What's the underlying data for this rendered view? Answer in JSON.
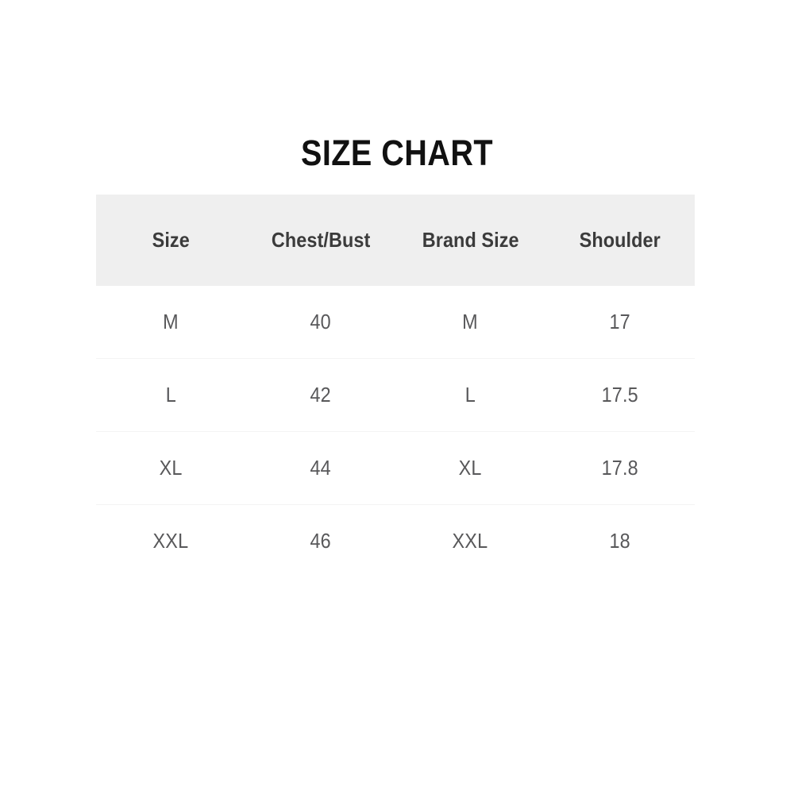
{
  "title": "SIZE CHART",
  "colors": {
    "background": "#ffffff",
    "title_text": "#111111",
    "header_background": "#efefef",
    "header_text": "#3b3b3b",
    "body_text": "#58585a",
    "row_divider": "#f4f4f4"
  },
  "table": {
    "headers": [
      "Size",
      "Chest/Bust",
      "Brand Size",
      "Shoulder"
    ],
    "rows": [
      {
        "size": "M",
        "chest_bust": "40",
        "brand_size": "M",
        "shoulder": "17"
      },
      {
        "size": "L",
        "chest_bust": "42",
        "brand_size": "L",
        "shoulder": "17.5"
      },
      {
        "size": "XL",
        "chest_bust": "44",
        "brand_size": "XL",
        "shoulder": "17.8"
      },
      {
        "size": "XXL",
        "chest_bust": "46",
        "brand_size": "XXL",
        "shoulder": "18"
      }
    ]
  },
  "chart_data": {
    "type": "table",
    "title": "SIZE CHART",
    "columns": [
      "Size",
      "Chest/Bust",
      "Brand Size",
      "Shoulder"
    ],
    "data": [
      [
        "M",
        "40",
        "M",
        "17"
      ],
      [
        "L",
        "42",
        "L",
        "17.5"
      ],
      [
        "XL",
        "44",
        "XL",
        "17.8"
      ],
      [
        "XXL",
        "46",
        "XXL",
        "18"
      ]
    ]
  }
}
